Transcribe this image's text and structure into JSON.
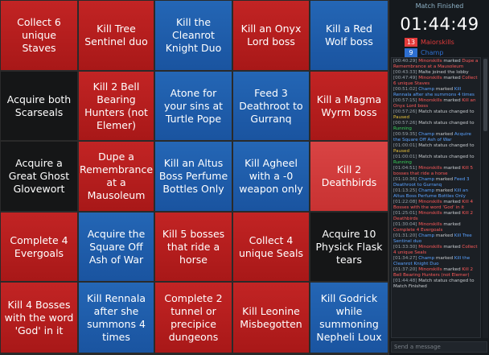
{
  "board": {
    "cells": [
      {
        "text": "Collect 6 unique Staves",
        "color": "red"
      },
      {
        "text": "Kill Tree Sentinel duo",
        "color": "red"
      },
      {
        "text": "Kill the Cleanrot Knight Duo",
        "color": "blue"
      },
      {
        "text": "Kill an Onyx Lord boss",
        "color": "red"
      },
      {
        "text": "Kill a Red Wolf boss",
        "color": "blue"
      },
      {
        "text": "Acquire both Scarseals",
        "color": "black"
      },
      {
        "text": "Kill 2 Bell Bearing Hunters (not Elemer)",
        "color": "red"
      },
      {
        "text": "Atone for your sins at Turtle Pope",
        "color": "blue"
      },
      {
        "text": "Feed 3 Deathroot to Gurranq",
        "color": "blue"
      },
      {
        "text": "Kill a Magma Wyrm boss",
        "color": "red"
      },
      {
        "text": "Acquire a Great Ghost Glovewort",
        "color": "black"
      },
      {
        "text": "Dupe a Remembrance at a Mausoleum",
        "color": "red"
      },
      {
        "text": "Kill an Altus Boss Perfume Bottles Only",
        "color": "blue"
      },
      {
        "text": "Kill Agheel with a -0 weapon only",
        "color": "blue"
      },
      {
        "text": "Kill 2 Deathbirds",
        "color": "sel"
      },
      {
        "text": "Complete 4 Evergoals",
        "color": "red"
      },
      {
        "text": "Acquire the Square Off Ash of War",
        "color": "blue"
      },
      {
        "text": "Kill 5 bosses that ride a horse",
        "color": "red"
      },
      {
        "text": "Collect 4 unique Seals",
        "color": "red"
      },
      {
        "text": "Acquire 10 Physick Flask tears",
        "color": "black"
      },
      {
        "text": "Kill 4 Bosses with the word 'God' in it",
        "color": "red"
      },
      {
        "text": "Kill Rennala after she summons 4 times",
        "color": "blue"
      },
      {
        "text": "Complete 2 tunnel or precipice dungeons",
        "color": "red"
      },
      {
        "text": "Kill Leonine Misbegotten",
        "color": "red"
      },
      {
        "text": "Kill Godrick while summoning Nepheli Loux",
        "color": "blue"
      }
    ]
  },
  "sidebar": {
    "status": "Match Finished",
    "timer": "01:44:49",
    "players": [
      {
        "score": "13",
        "name": "Maiorskills",
        "color": "#e23b3b"
      },
      {
        "score": "9",
        "name": "Champ",
        "color": "#2e6fd0"
      }
    ],
    "log": [
      [
        {
          "c": "t",
          "x": "[00:40:29] "
        },
        {
          "c": "r",
          "x": "Minorskills"
        },
        {
          "c": "",
          "x": " marked "
        },
        {
          "c": "r",
          "x": "Dupe a Remembrance at a Mausoleum"
        }
      ],
      [
        {
          "c": "t",
          "x": "[00:43:33] "
        },
        {
          "c": "",
          "x": "Malte joined the lobby"
        }
      ],
      [
        {
          "c": "t",
          "x": "[00:47:49] "
        },
        {
          "c": "r",
          "x": "Minorskills"
        },
        {
          "c": "",
          "x": " marked "
        },
        {
          "c": "r",
          "x": "Collect 6 unique Staves"
        }
      ],
      [
        {
          "c": "t",
          "x": "[00:51:02] "
        },
        {
          "c": "b",
          "x": "Champ"
        },
        {
          "c": "",
          "x": " marked "
        },
        {
          "c": "b",
          "x": "Kill Rennala after she summons 4 times"
        }
      ],
      [
        {
          "c": "t",
          "x": "[00:57:15] "
        },
        {
          "c": "r",
          "x": "Minorskills"
        },
        {
          "c": "",
          "x": " marked "
        },
        {
          "c": "r",
          "x": "Kill an Onyx Lord boss"
        }
      ],
      [
        {
          "c": "t",
          "x": "[00:57:26] "
        },
        {
          "c": "",
          "x": "Match status changed to "
        },
        {
          "c": "y",
          "x": "Paused"
        }
      ],
      [
        {
          "c": "t",
          "x": "[00:57:26] "
        },
        {
          "c": "",
          "x": "Match status changed to "
        },
        {
          "c": "g",
          "x": "Running"
        }
      ],
      [
        {
          "c": "t",
          "x": "[00:59:35] "
        },
        {
          "c": "b",
          "x": "Champ"
        },
        {
          "c": "",
          "x": " marked "
        },
        {
          "c": "b",
          "x": "Acquire the Square Off Ash of War"
        }
      ],
      [
        {
          "c": "t",
          "x": "[01:00:01] "
        },
        {
          "c": "",
          "x": "Match status changed to "
        },
        {
          "c": "y",
          "x": "Paused"
        }
      ],
      [
        {
          "c": "t",
          "x": "[01:00:01] "
        },
        {
          "c": "",
          "x": "Match status changed to "
        },
        {
          "c": "g",
          "x": "Running"
        }
      ],
      [
        {
          "c": "t",
          "x": "[01:04:51] "
        },
        {
          "c": "r",
          "x": "Minorskills"
        },
        {
          "c": "",
          "x": " marked "
        },
        {
          "c": "r",
          "x": "Kill 5 bosses that ride a horse"
        }
      ],
      [
        {
          "c": "t",
          "x": "[01:10:36] "
        },
        {
          "c": "b",
          "x": "Champ"
        },
        {
          "c": "",
          "x": " marked "
        },
        {
          "c": "b",
          "x": "Feed 3 Deathroot to Gurranq"
        }
      ],
      [
        {
          "c": "t",
          "x": "[01:13:25] "
        },
        {
          "c": "b",
          "x": "Champ"
        },
        {
          "c": "",
          "x": " marked "
        },
        {
          "c": "b",
          "x": "Kill an Altus Boss Perfume Bottles Only"
        }
      ],
      [
        {
          "c": "t",
          "x": "[01:22:08] "
        },
        {
          "c": "r",
          "x": "Minorskills"
        },
        {
          "c": "",
          "x": " marked "
        },
        {
          "c": "r",
          "x": "Kill 4 Bosses with the word 'God' in it"
        }
      ],
      [
        {
          "c": "t",
          "x": "[01:25:01] "
        },
        {
          "c": "r",
          "x": "Minorskills"
        },
        {
          "c": "",
          "x": " marked "
        },
        {
          "c": "r",
          "x": "Kill 2 Deathbirds"
        }
      ],
      [
        {
          "c": "t",
          "x": "[01:30:04] "
        },
        {
          "c": "r",
          "x": "Minorskills"
        },
        {
          "c": "",
          "x": " marked "
        },
        {
          "c": "r",
          "x": "Complete 4 Evergoals"
        }
      ],
      [
        {
          "c": "t",
          "x": "[01:31:20] "
        },
        {
          "c": "b",
          "x": "Champ"
        },
        {
          "c": "",
          "x": " marked "
        },
        {
          "c": "b",
          "x": "Kill Tree Sentinel duo"
        }
      ],
      [
        {
          "c": "t",
          "x": "[01:33:30] "
        },
        {
          "c": "r",
          "x": "Minorskills"
        },
        {
          "c": "",
          "x": " marked "
        },
        {
          "c": "r",
          "x": "Collect 4 unique Seals"
        }
      ],
      [
        {
          "c": "t",
          "x": "[01:34:27] "
        },
        {
          "c": "b",
          "x": "Champ"
        },
        {
          "c": "",
          "x": " marked "
        },
        {
          "c": "b",
          "x": "Kill the Cleanrot Knight Duo"
        }
      ],
      [
        {
          "c": "t",
          "x": "[01:37:20] "
        },
        {
          "c": "r",
          "x": "Minorskills"
        },
        {
          "c": "",
          "x": " marked "
        },
        {
          "c": "r",
          "x": "Kill 2 Bell Bearing Hunters (not Elemer)"
        }
      ],
      [
        {
          "c": "t",
          "x": "[01:44:48] "
        },
        {
          "c": "",
          "x": "Match status changed to "
        },
        {
          "c": "",
          "x": "Match Finished"
        }
      ]
    ],
    "message_placeholder": "Send a message"
  }
}
